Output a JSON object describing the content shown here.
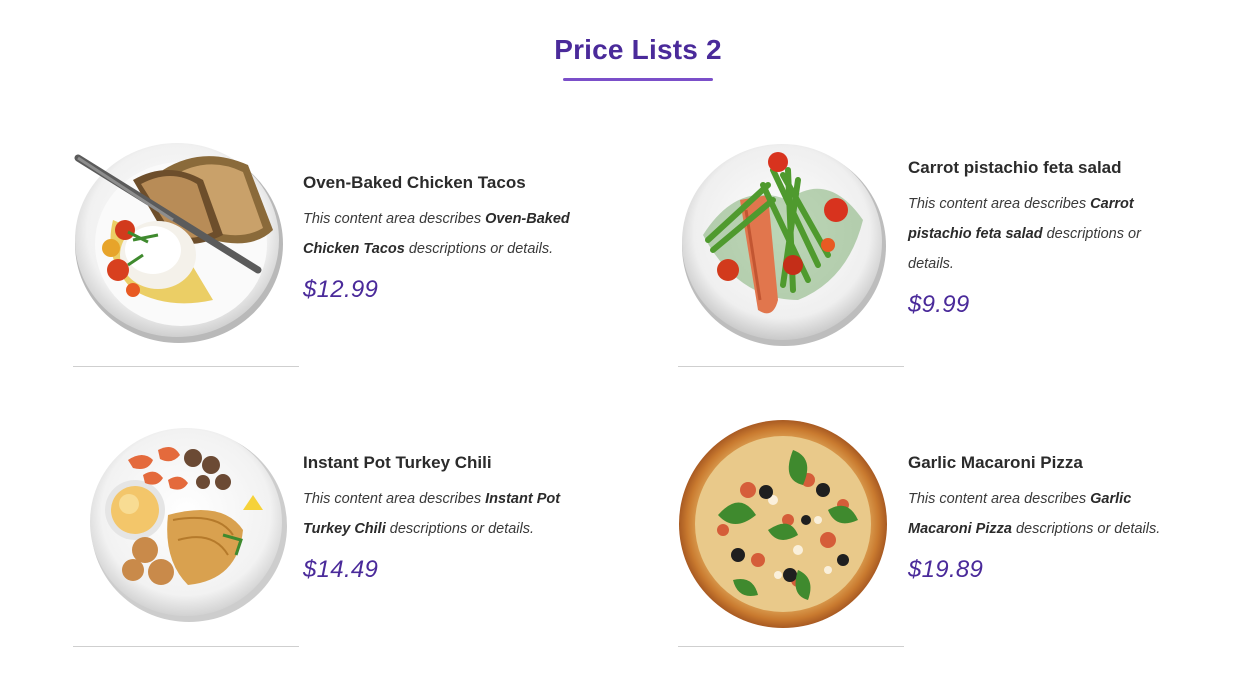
{
  "section": {
    "title": "Price Lists 2"
  },
  "items": [
    {
      "name": "Oven-Baked Chicken Tacos",
      "desc_prefix": "This content area describes ",
      "desc_bold": "Oven-Baked Chicken Tacos",
      "desc_suffix": " descriptions or details.",
      "price": "$12.99",
      "image_icon": "plate-burrata-bread-icon"
    },
    {
      "name": "Carrot pistachio feta salad",
      "desc_prefix": "This content area describes ",
      "desc_bold": "Carrot pistachio feta salad",
      "desc_suffix": " descriptions or details.",
      "price": "$9.99",
      "image_icon": "plate-salmon-asparagus-icon"
    },
    {
      "name": "Instant Pot Turkey Chili",
      "desc_prefix": "This content area describes ",
      "desc_bold": "Instant Pot Turkey Chili",
      "desc_suffix": " descriptions or details.",
      "price": "$14.49",
      "image_icon": "plate-seafood-fish-icon"
    },
    {
      "name": "Garlic Macaroni Pizza",
      "desc_prefix": "This content area describes ",
      "desc_bold": "Garlic Macaroni Pizza",
      "desc_suffix": " descriptions or details.",
      "price": "$19.89",
      "image_icon": "pizza-icon"
    }
  ],
  "colors": {
    "accent": "#4a2a9a",
    "underline": "#7b4fc9",
    "divider": "#cfcfcf"
  }
}
